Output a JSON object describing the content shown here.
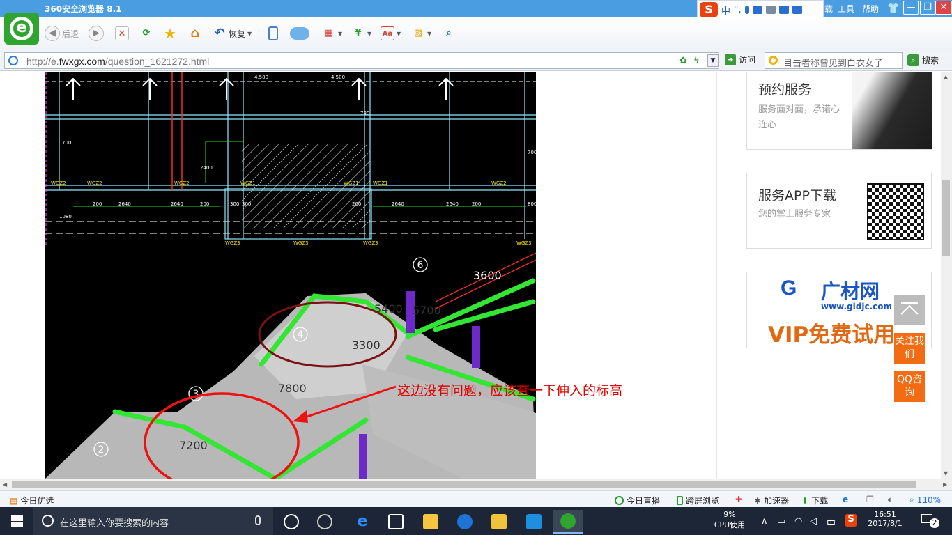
{
  "window": {
    "title": "360安全浏览器 8.1"
  },
  "ime": {
    "lang": "中",
    "punct": "°,"
  },
  "title_menus": {
    "download": "载",
    "tools": "工具",
    "help": "帮助"
  },
  "window_controls": {
    "minimize": "—",
    "maximize": "❐",
    "close": "✕"
  },
  "toolbar": {
    "back": "后退",
    "restore": "恢复"
  },
  "address": {
    "url_prefix": "http://e.",
    "url_domain": "fwxgx.com",
    "url_suffix": "/question_1621272.html",
    "visit": "访问"
  },
  "search": {
    "placeholder": "目击者称曾见到白衣女子",
    "button": "搜索"
  },
  "cad": {
    "dims_top": [
      "4,500",
      "4,500"
    ],
    "labels": [
      "700",
      "2400",
      "780",
      "700",
      "200",
      "2640",
      "2640",
      "200",
      "300",
      "300",
      "200",
      "2640",
      "2640",
      "200",
      "800",
      "1080"
    ],
    "beam_labels": [
      "WGZ2",
      "WGZ2",
      "WGZ2",
      "WGZ1",
      "WGZ1",
      "WGZ1",
      "WGZ2",
      "WGZ3",
      "WGZ3",
      "WGZ3",
      "WGZ3"
    ],
    "axis_numbers": [
      "6",
      "4",
      "3",
      "2"
    ],
    "dims_3d": [
      "3600",
      "5700",
      "5400",
      "3300",
      "7800",
      "7200"
    ],
    "annotation": "这边没有问题，应该查一下伸入的标高"
  },
  "sidebar": {
    "service": {
      "title": "预约服务",
      "subtitle": "服务面对面，承诺心连心"
    },
    "app": {
      "title": "服务APP下载",
      "subtitle": "您的掌上服务专家"
    },
    "ad": {
      "brand": "广材网",
      "url": "www.gldjc.com",
      "slogan": "VIP免费试用"
    },
    "follow": "关注我们",
    "qq": "QQ咨询"
  },
  "statusbar": {
    "left": "今日优选",
    "live": "今日直播",
    "cross_screen": "跨屏浏览",
    "accelerator": "加速器",
    "download": "下载",
    "zoom": "110%"
  },
  "taskbar": {
    "search_placeholder": "在这里输入你要搜索的内容",
    "cpu_percent": "9%",
    "cpu_label": "CPU使用",
    "ime": "中",
    "time": "16:51",
    "date": "2017/8/1",
    "notifications": "2"
  },
  "colors": {
    "titlebar": "#4a9de0",
    "logo": "#2fa52f",
    "accent": "#f36b12",
    "annotation": "#e00000"
  }
}
